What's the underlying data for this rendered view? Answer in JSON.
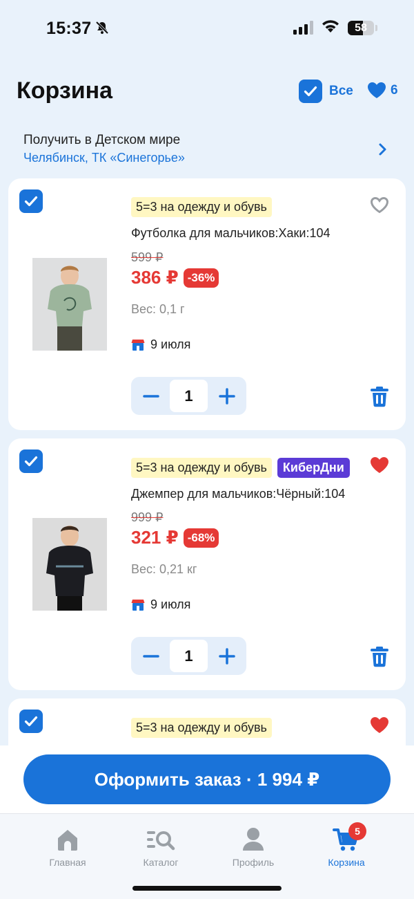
{
  "status_bar": {
    "time": "15:37",
    "battery": "58",
    "battery_level": 0.58
  },
  "header": {
    "title": "Корзина",
    "select_all_label": "Все",
    "favorites_count": "6"
  },
  "pickup": {
    "title": "Получить в Детском мире",
    "address": "Челябинск, ТК «Синегорье»"
  },
  "cart": {
    "items": [
      {
        "checked": true,
        "promo": "5=3 на одежду и обувь",
        "name": "Футболка для мальчиков:Хаки:104",
        "old_price": "599 ₽",
        "price": "386 ₽",
        "discount": "-36%",
        "weight": "Вес: 0,1 г",
        "delivery": "9 июля",
        "quantity": "1",
        "favorite": false,
        "image_icon": "tshirt-photo"
      },
      {
        "checked": true,
        "promo": "5=3 на одежду и обувь",
        "extra_badge": "КиберДни",
        "name": "Джемпер для мальчиков:Чёрный:104",
        "old_price": "999 ₽",
        "price": "321 ₽",
        "discount": "-68%",
        "weight": "Вес: 0,21 кг",
        "delivery": "9 июля",
        "quantity": "1",
        "favorite": true,
        "image_icon": "sweater-photo"
      },
      {
        "checked": true,
        "promo": "5=3 на одежду и обувь",
        "favorite": true
      }
    ]
  },
  "checkout": {
    "label": "Оформить заказ · 1 994 ₽"
  },
  "tabbar": {
    "tabs": [
      {
        "label": "Главная",
        "icon": "home-icon"
      },
      {
        "label": "Каталог",
        "icon": "catalog-search-icon"
      },
      {
        "label": "Профиль",
        "icon": "profile-icon"
      },
      {
        "label": "Корзина",
        "icon": "cart-icon",
        "badge": "5",
        "active": true
      }
    ]
  },
  "colors": {
    "accent": "#1a73d9",
    "price_red": "#e53935",
    "background": "#e9f2fb",
    "promo_yellow": "#fff7c2",
    "cyber_purple": "#5b3bd6"
  }
}
